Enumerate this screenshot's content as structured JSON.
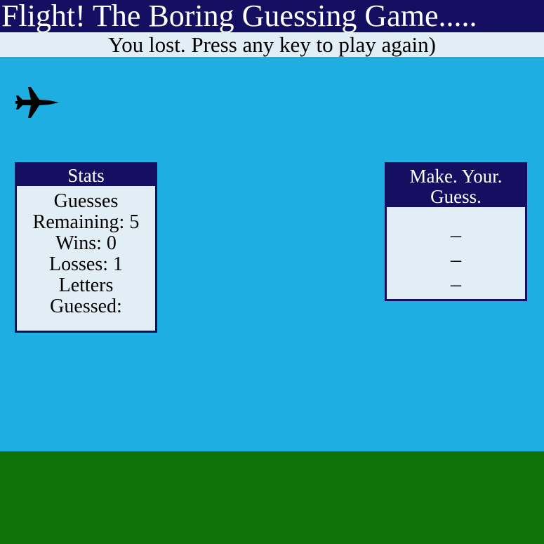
{
  "header": {
    "title": "Flight! The Boring Guessing Game.....",
    "status": "You lost. Press any key to play again)"
  },
  "plane": {
    "icon": "fighter-jet-icon",
    "color": "#000000"
  },
  "stats": {
    "title": "Stats",
    "guesses_label": "Guesses",
    "remaining_text": "Remaining: 5",
    "wins_text": "Wins: 0",
    "losses_text": "Losses: 1",
    "letters_label": "Letters",
    "guessed_label": "Guessed:"
  },
  "guess_panel": {
    "title_line1": "Make. Your.",
    "title_line2": "Guess.",
    "blanks": [
      "_",
      "_",
      "_"
    ]
  },
  "colors": {
    "sky": "#1eaee2",
    "ground": "#0f7209",
    "navy": "#150f62",
    "panel": "#e2eef6"
  }
}
